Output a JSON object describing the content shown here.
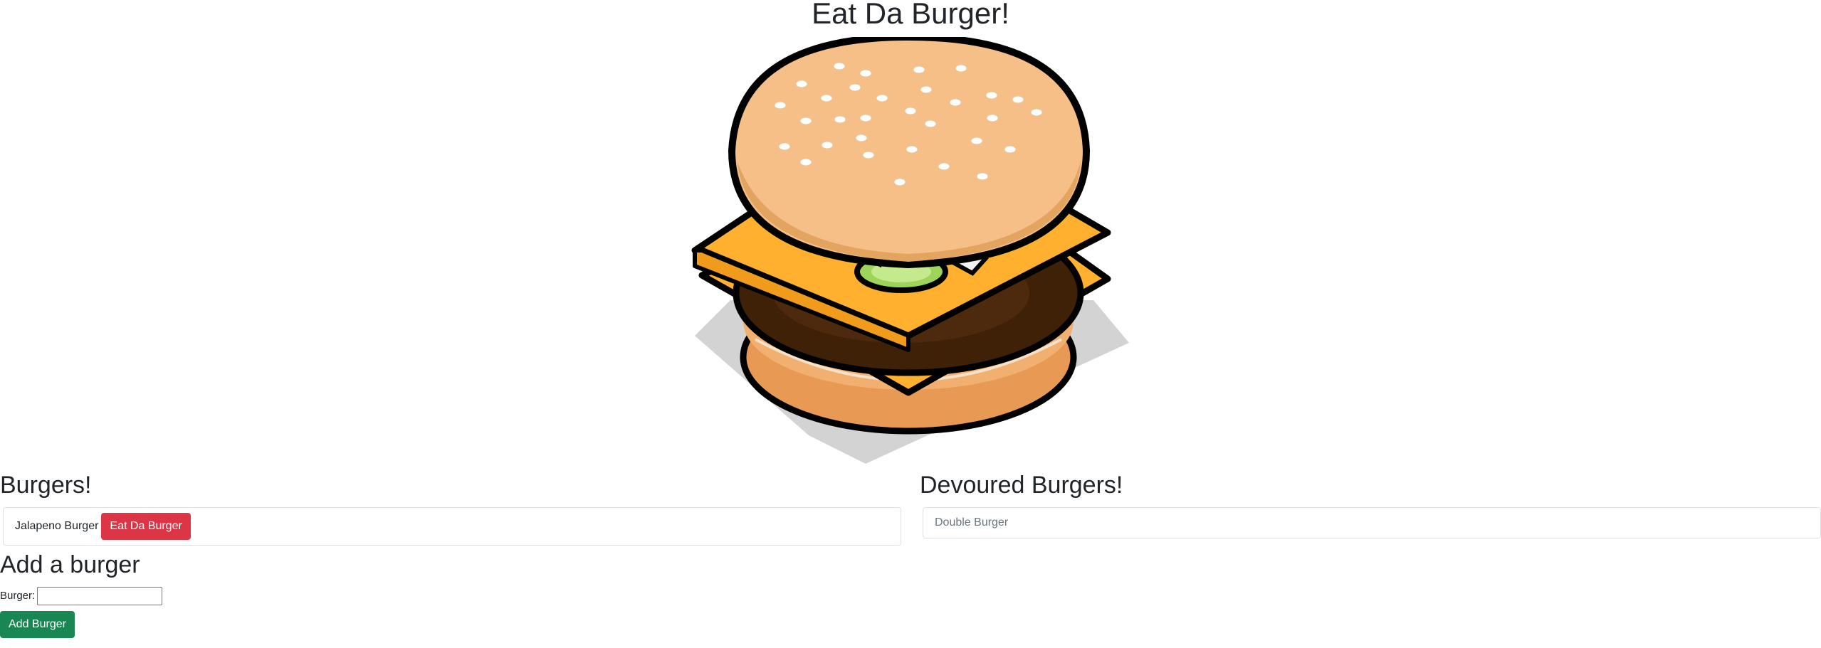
{
  "page_title": "Eat Da Burger!",
  "burgers_section": {
    "heading": "Burgers!",
    "items": [
      {
        "name": "Jalapeno Burger",
        "button_label": "Eat Da Burger"
      }
    ]
  },
  "devoured_section": {
    "heading": "Devoured Burgers!",
    "items": [
      {
        "name": "Double Burger"
      }
    ]
  },
  "add_section": {
    "heading": "Add a burger",
    "field_label": "Burger:",
    "field_value": "",
    "button_label": "Add Burger"
  },
  "colors": {
    "eat_button": "#dc3545",
    "add_button": "#198754",
    "bun_top": "#f5bf87",
    "bun_bottom": "#e89a55",
    "patty": "#3f2108",
    "cheese": "#ffb02e",
    "tomato": "#d60f0f",
    "lettuce": "#9ed45a",
    "shadow": "#d3d3d3"
  },
  "icons": {
    "hero_image": "burger-illustration"
  }
}
